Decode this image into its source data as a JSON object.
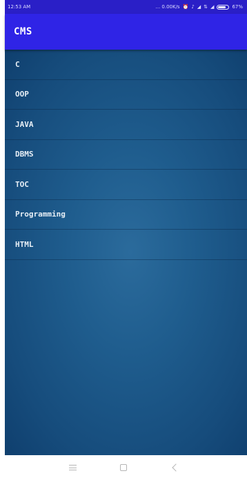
{
  "status_bar": {
    "time": "12:53 AM",
    "indicators": "... 0.00K/s",
    "icon_names": [
      "alarm-icon",
      "volume-icon",
      "signal-icon",
      "wifi-icon",
      "signal-icon",
      "battery-icon"
    ],
    "battery": "67%"
  },
  "app_bar": {
    "title": "CMS",
    "color": "#2f24e6"
  },
  "topics": [
    "C",
    "OOP",
    "JAVA",
    "DBMS",
    "TOC",
    "Programming",
    "HTML"
  ],
  "nav_bar": {
    "buttons": [
      "menu-icon",
      "home-icon",
      "back-icon"
    ]
  }
}
